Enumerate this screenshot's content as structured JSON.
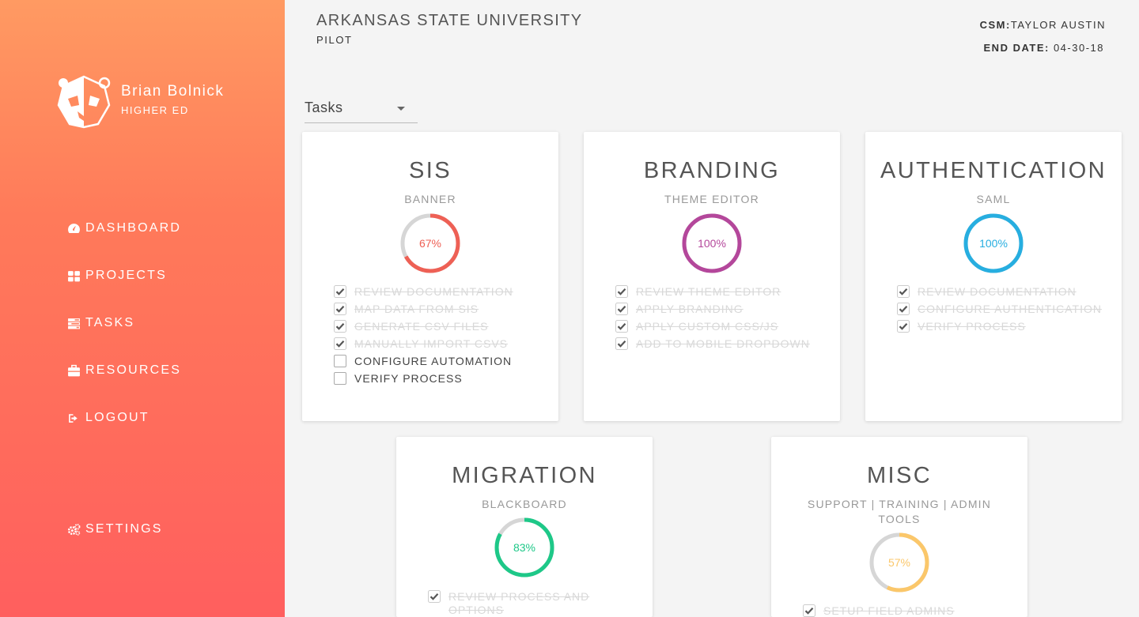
{
  "sidebar": {
    "profile": {
      "name": "Brian Bolnick",
      "role": "HIGHER ED"
    },
    "nav": [
      {
        "label": "DASHBOARD",
        "icon": "dashboard-icon"
      },
      {
        "label": "PROJECTS",
        "icon": "grid-icon"
      },
      {
        "label": "TASKS",
        "icon": "tasks-icon"
      },
      {
        "label": "RESOURCES",
        "icon": "briefcase-icon"
      },
      {
        "label": "LOGOUT",
        "icon": "logout-icon"
      }
    ],
    "settings": {
      "label": "SETTINGS",
      "icon": "gears-icon"
    }
  },
  "header": {
    "title": "ARKANSAS STATE UNIVERSITY",
    "subtitle": "PILOT",
    "csm_label": "CSM:",
    "csm_value": "TAYLOR AUSTIN",
    "end_label": "END DATE:",
    "end_value": "04-30-18"
  },
  "filter": {
    "selected": "Tasks"
  },
  "colors": {
    "sis": "#ee6055",
    "branding": "#b4479b",
    "authentication": "#27aee0",
    "migration": "#1ec888",
    "misc": "#fbc76a",
    "ring_track": "#d6d6d6"
  },
  "cards": [
    {
      "title": "SIS",
      "subtitle": "BANNER",
      "progress_label": "67%",
      "progress": 0.67,
      "tasks": [
        {
          "label": "REVIEW DOCUMENTATION",
          "done": true
        },
        {
          "label": "MAP DATA FROM SIS",
          "done": true
        },
        {
          "label": "GENERATE CSV FILES",
          "done": true
        },
        {
          "label": "MANUALLY IMPORT CSVS",
          "done": true
        },
        {
          "label": "CONFIGURE AUTOMATION",
          "done": false
        },
        {
          "label": "VERIFY PROCESS",
          "done": false
        }
      ]
    },
    {
      "title": "BRANDING",
      "subtitle": "THEME EDITOR",
      "progress_label": "100%",
      "progress": 1.0,
      "tasks": [
        {
          "label": "REVIEW THEME EDITOR",
          "done": true
        },
        {
          "label": "APPLY BRANDING",
          "done": true
        },
        {
          "label": "APPLY CUSTOM CSS/JS",
          "done": true
        },
        {
          "label": "ADD TO MOBILE DROPDOWN",
          "done": true
        }
      ]
    },
    {
      "title": "AUTHENTICATION",
      "subtitle": "SAML",
      "progress_label": "100%",
      "progress": 1.0,
      "tasks": [
        {
          "label": "REVIEW DOCUMENTATION",
          "done": true
        },
        {
          "label": "CONFIGURE AUTHENTICATION",
          "done": true
        },
        {
          "label": "VERIFY PROCESS",
          "done": true
        }
      ]
    },
    {
      "title": "MIGRATION",
      "subtitle": "BLACKBOARD",
      "progress_label": "83%",
      "progress": 0.83,
      "tasks": [
        {
          "label": "REVIEW PROCESS AND OPTIONS",
          "done": true
        }
      ]
    },
    {
      "title": "MISC",
      "subtitle": "SUPPORT | TRAINING | ADMIN TOOLS",
      "progress_label": "57%",
      "progress": 0.57,
      "tasks": [
        {
          "label": "SETUP FIELD ADMINS",
          "done": true
        }
      ]
    }
  ]
}
